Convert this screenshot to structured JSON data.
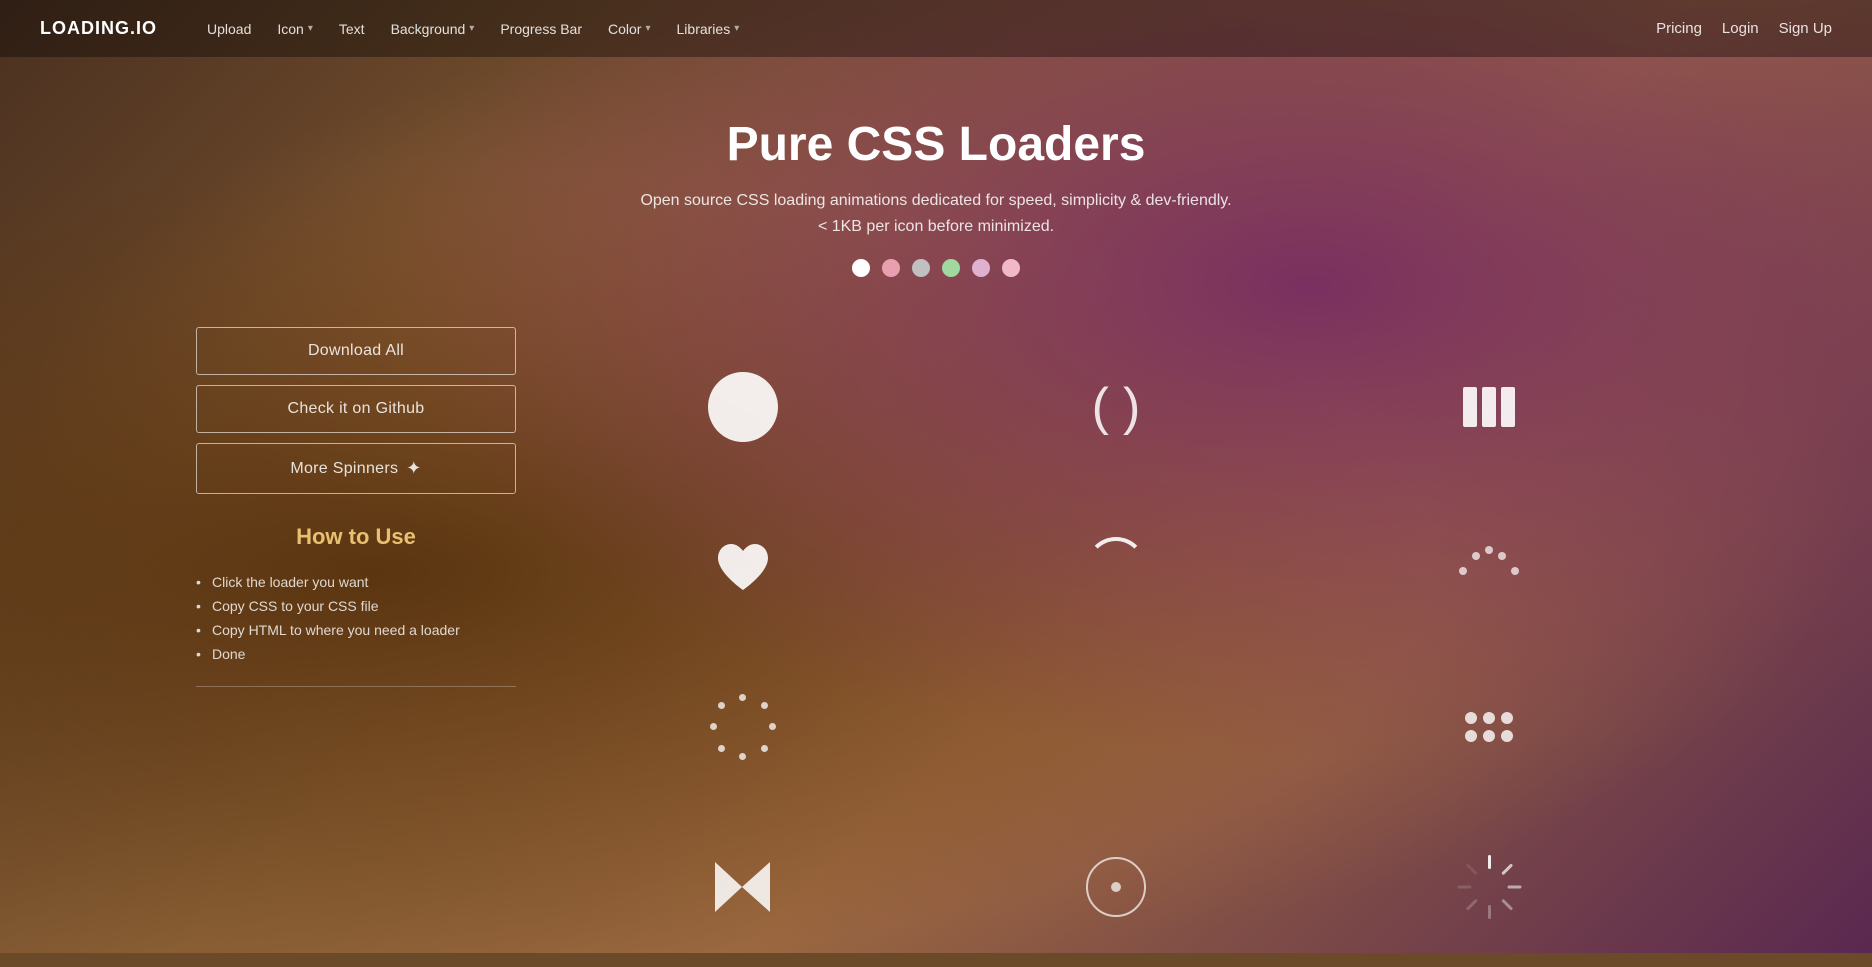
{
  "site": {
    "logo": "LOADING.IO"
  },
  "nav": {
    "links": [
      {
        "id": "upload",
        "label": "Upload",
        "hasDropdown": false
      },
      {
        "id": "icon",
        "label": "Icon",
        "hasDropdown": true
      },
      {
        "id": "text",
        "label": "Text",
        "hasDropdown": false
      },
      {
        "id": "background",
        "label": "Background",
        "hasDropdown": true
      },
      {
        "id": "progress-bar",
        "label": "Progress Bar",
        "hasDropdown": false
      },
      {
        "id": "color",
        "label": "Color",
        "hasDropdown": true
      },
      {
        "id": "libraries",
        "label": "Libraries",
        "hasDropdown": true
      }
    ],
    "right": [
      {
        "id": "pricing",
        "label": "Pricing"
      },
      {
        "id": "login",
        "label": "Login"
      },
      {
        "id": "signup",
        "label": "Sign Up"
      }
    ]
  },
  "hero": {
    "title": "Pure CSS Loaders",
    "subtitle_line1": "Open source CSS loading animations dedicated for speed, simplicity & dev-friendly.",
    "subtitle_line2": "< 1KB per icon before minimized.",
    "color_dots": [
      {
        "id": "dot1",
        "color": "#ffffff"
      },
      {
        "id": "dot2",
        "color": "#e8a0b0"
      },
      {
        "id": "dot3",
        "color": "#c0c0c0"
      },
      {
        "id": "dot4",
        "color": "#a0d8a0"
      },
      {
        "id": "dot5",
        "color": "#e0b0d0"
      },
      {
        "id": "dot6",
        "color": "#f0b8c8"
      }
    ]
  },
  "buttons": {
    "download_all": "Download All",
    "check_github": "Check it on Github",
    "more_spinners": "More Spinners"
  },
  "how_to_use": {
    "title": "How to Use",
    "steps": [
      "Click the loader you want",
      "Copy CSS to your CSS file",
      "Copy HTML to where you need a loader",
      "Done"
    ]
  },
  "colors": {
    "accent": "#e8c070",
    "bg_dark": "rgba(0,0,0,0.35)",
    "white_85": "rgba(255,255,255,0.85)"
  }
}
